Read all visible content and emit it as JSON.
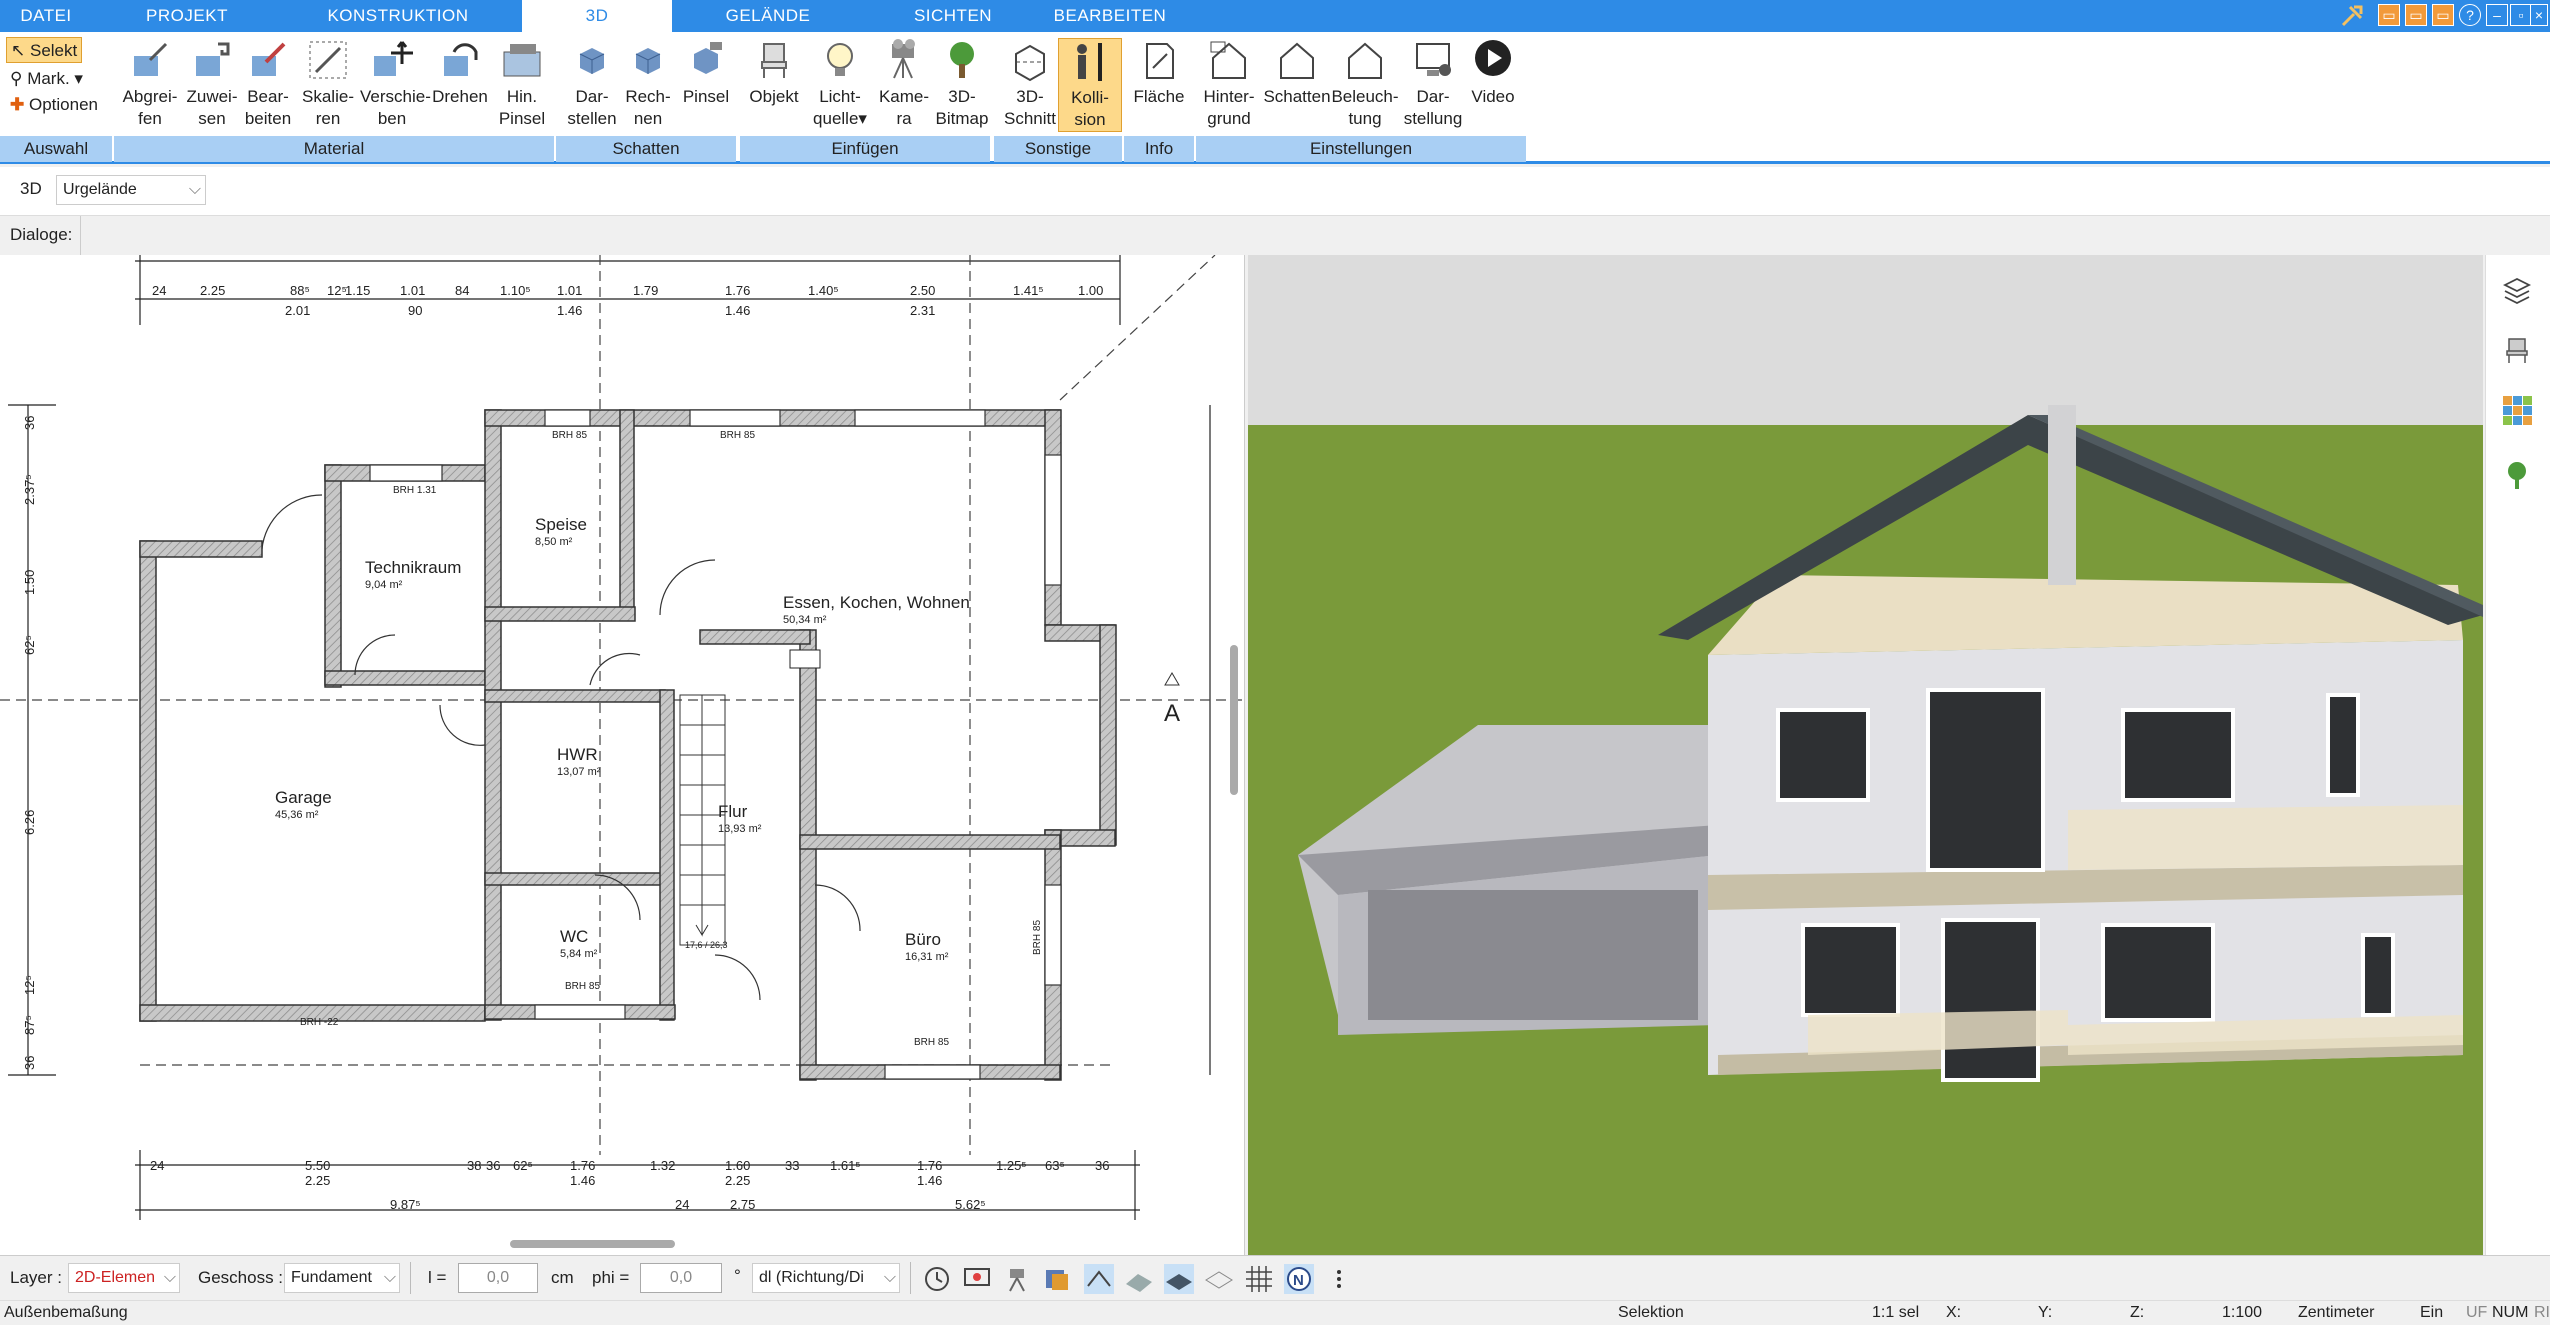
{
  "tabs": [
    "DATEI",
    "PROJEKT",
    "KONSTRUKTION",
    "3D",
    "GELÄNDE",
    "SICHTEN",
    "BEARBEITEN"
  ],
  "selection": {
    "selekt": "Selekt",
    "mark": "Mark.",
    "optionen": "Optionen",
    "group": "Auswahl"
  },
  "material": {
    "group": "Material",
    "buttons": [
      {
        "l1": "Abgrei-",
        "l2": "fen"
      },
      {
        "l1": "Zuwei-",
        "l2": "sen"
      },
      {
        "l1": "Bear-",
        "l2": "beiten"
      },
      {
        "l1": "Skalie-",
        "l2": "ren"
      },
      {
        "l1": "Verschie-",
        "l2": "ben"
      },
      {
        "l1": "Drehen",
        "l2": ""
      },
      {
        "l1": "Hin.",
        "l2": "Pinsel"
      }
    ]
  },
  "schatten": {
    "group": "Schatten",
    "buttons": [
      {
        "l1": "Dar-",
        "l2": "stellen"
      },
      {
        "l1": "Rech-",
        "l2": "nen"
      },
      {
        "l1": "Pinsel",
        "l2": ""
      }
    ]
  },
  "einfuegen": {
    "group": "Einfügen",
    "buttons": [
      {
        "l1": "Objekt",
        "l2": ""
      },
      {
        "l1": "Licht-",
        "l2": "quelle"
      },
      {
        "l1": "Kame-",
        "l2": "ra"
      },
      {
        "l1": "3D-",
        "l2": "Bitmap"
      }
    ]
  },
  "sonstige": {
    "group": "Sonstige",
    "buttons": [
      {
        "l1": "3D-",
        "l2": "Schnitt"
      },
      {
        "l1": "Kolli-",
        "l2": "sion"
      }
    ]
  },
  "info": {
    "group": "Info",
    "buttons": [
      {
        "l1": "Fläche",
        "l2": ""
      }
    ]
  },
  "einstellungen": {
    "group": "Einstellungen",
    "buttons": [
      {
        "l1": "Hinter-",
        "l2": "grund"
      },
      {
        "l1": "Schatten",
        "l2": ""
      },
      {
        "l1": "Beleuch-",
        "l2": "tung"
      },
      {
        "l1": "Dar-",
        "l2": "stellung"
      },
      {
        "l1": "Video",
        "l2": ""
      }
    ]
  },
  "viewbar": {
    "mode": "3D",
    "terrain": "Urgelände",
    "dialoge": "Dialoge:"
  },
  "plan": {
    "rooms": [
      {
        "name": "Technikraum",
        "area": "9,04 m²"
      },
      {
        "name": "Speise",
        "area": "8,50 m²"
      },
      {
        "name": "Essen, Kochen, Wohnen",
        "area": "50,34 m²"
      },
      {
        "name": "Garage",
        "area": "45,36 m²"
      },
      {
        "name": "HWR",
        "area": "13,07 m²"
      },
      {
        "name": "Flur",
        "area": "13,93 m²"
      },
      {
        "name": "WC",
        "area": "5,84 m²"
      },
      {
        "name": "Büro",
        "area": "16,31 m²"
      }
    ],
    "top_dims": [
      "24",
      "2.25",
      "88⁵",
      "12⁵",
      "1.15",
      "1.01",
      "84",
      "1.10⁵",
      "1.01",
      "1.79",
      "1.76",
      "1.40⁵",
      "2.50",
      "1.41⁵",
      "1.00"
    ],
    "top_dims2": [
      "2.01",
      "90",
      "1.46",
      "1.46",
      "2.31"
    ],
    "bottom_dims": [
      "24",
      "5.50",
      "38",
      "36",
      "62⁵",
      "1.76",
      "1.32",
      "1.60",
      "33",
      "1.61⁵",
      "1.76",
      "1.25⁵",
      "63⁵",
      "36"
    ],
    "bottom_dims2": [
      "2.25",
      "1.46",
      "2.25",
      "1.46"
    ],
    "bottom_dims3": [
      "9.87⁵",
      "24",
      "2.75",
      "5.62⁵"
    ],
    "left_dims": [
      "36",
      "2.37⁵",
      "1.50",
      "62⁵",
      "6.26",
      "12⁵",
      "87⁵",
      "36"
    ],
    "brh": [
      "BRH 85",
      "BRH 85",
      "BRH 1.31",
      "BRH 85",
      "BRH 85",
      "BRH -22",
      "BRH 85"
    ],
    "section": "A",
    "stair": "17,6 / 26,3"
  },
  "bottom": {
    "layer_label": "Layer :",
    "layer_value": "2D-Elemen",
    "geschoss_label": "Geschoss :",
    "geschoss_value": "Fundament",
    "l_label": "l =",
    "l_value": "0,0",
    "l_unit": "cm",
    "phi_label": "phi =",
    "phi_value": "0,0",
    "phi_unit": "°",
    "dl_value": "dl (Richtung/Di"
  },
  "status": {
    "left": "Außenbemaßung",
    "selektion": "Selektion",
    "sel": "1:1 sel",
    "x": "X:",
    "y": "Y:",
    "z": "Z:",
    "scale": "1:100",
    "unit": "Zentimeter",
    "ein": "Ein",
    "uf": "UF",
    "num": "NUM",
    "ri": "RI"
  },
  "colors": {
    "tab_blue": "#2e8be6",
    "group_blue": "#a9cff4",
    "active_orange": "#fdd98a",
    "room_red": "#cc2222"
  }
}
